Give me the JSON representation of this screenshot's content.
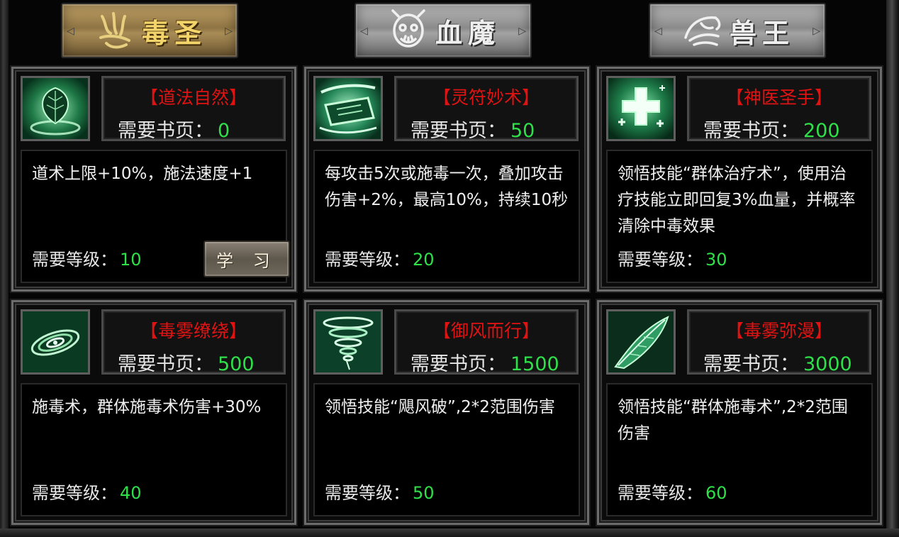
{
  "tabs": [
    {
      "label": "毒圣",
      "state": "active",
      "emblem": "claw-emblem-icon"
    },
    {
      "label": "血魔",
      "state": "inactive",
      "emblem": "demon-face-emblem-icon"
    },
    {
      "label": "兽王",
      "state": "inactive",
      "emblem": "beast-emblem-icon"
    }
  ],
  "pages_label": "需要书页：",
  "level_label": "需要等级：",
  "skills": [
    {
      "name": "【道法自然】",
      "pages": "0",
      "description": "道术上限+10%，施法速度+1",
      "level": "10",
      "learn_label": "学 习",
      "icon": "leaf-skill-icon"
    },
    {
      "name": "【灵符妙术】",
      "pages": "50",
      "description": "每攻击5次或施毒一次，叠加攻击伤害+2%，最高10%，持续10秒",
      "level": "20",
      "icon": "talisman-skill-icon"
    },
    {
      "name": "【神医圣手】",
      "pages": "200",
      "description": "领悟技能“群体治疗术”，使用治疗技能立即回复3%血量，并概率清除中毒效果",
      "level": "30",
      "icon": "healing-cross-skill-icon"
    },
    {
      "name": "【毒雾缭绕】",
      "pages": "500",
      "description": "施毒术，群体施毒术伤害+30%",
      "level": "40",
      "icon": "poison-swirl-skill-icon"
    },
    {
      "name": "【御风而行】",
      "pages": "1500",
      "description": "领悟技能“飓风破”,2*2范围伤害",
      "level": "50",
      "icon": "tornado-skill-icon"
    },
    {
      "name": "【毒雾弥漫】",
      "pages": "3000",
      "description": "领悟技能“群体施毒术”,2*2范围伤害",
      "level": "60",
      "icon": "poison-feather-skill-icon"
    }
  ],
  "colors": {
    "skill_name": "#e01212",
    "value_green": "#2fe04a",
    "active_tab": "#c4a468",
    "inactive_tab": "#a3a3a3"
  }
}
